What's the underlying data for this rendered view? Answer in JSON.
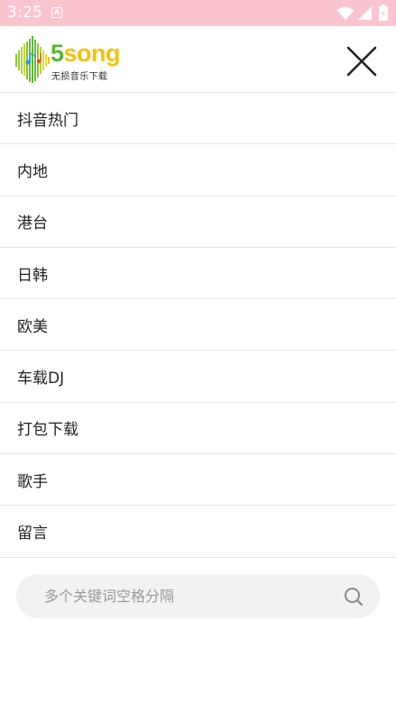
{
  "status_bar": {
    "time": "3:25",
    "notification_icon": "a-icon",
    "notification_letter": "A",
    "icons": [
      "wifi-icon",
      "signal-icon",
      "battery-icon"
    ]
  },
  "header": {
    "logo_brand_digit": "5",
    "logo_brand_word": "song",
    "logo_subtitle": "无损音乐下载",
    "close_icon": "close-icon"
  },
  "menu": {
    "items": [
      {
        "label": "抖音热门"
      },
      {
        "label": "内地"
      },
      {
        "label": "港台"
      },
      {
        "label": "日韩"
      },
      {
        "label": "欧美"
      },
      {
        "label": "车载DJ"
      },
      {
        "label": "打包下载"
      },
      {
        "label": "歌手"
      },
      {
        "label": "留言"
      }
    ]
  },
  "search": {
    "placeholder": "多个关键词空格分隔",
    "value": "",
    "icon": "search-icon"
  },
  "colors": {
    "status_bar_bg": "#fbc5d0",
    "logo_green": "#59b63a",
    "logo_yellow": "#f4c20d",
    "divider": "#e6e6e6",
    "search_bg": "#f2f2f2"
  }
}
